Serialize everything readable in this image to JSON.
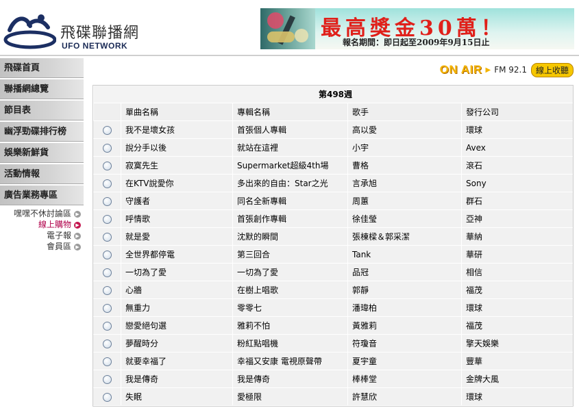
{
  "header": {
    "site_name": "飛碟聯播網",
    "site_sub": "UFO NETWORK",
    "banner_headline": "最高獎金30萬！",
    "banner_sub": "報名期間：即日起至2009年9月15日止"
  },
  "sidebar": {
    "items": [
      {
        "label": "飛碟首頁"
      },
      {
        "label": "聯播網總覽"
      },
      {
        "label": "節目表"
      },
      {
        "label": "幽浮勁碟排行榜"
      },
      {
        "label": "娛樂新鮮貨"
      },
      {
        "label": "活動情報"
      },
      {
        "label": "廣告業務專區"
      }
    ],
    "sub_links": [
      {
        "label": "嘿嘿不休討論區"
      },
      {
        "label": "線上購物"
      },
      {
        "label": "電子報"
      },
      {
        "label": "會員區"
      }
    ]
  },
  "onair": {
    "label": "ON AIR",
    "frequency": "FM 92.1",
    "listen_button": "線上收聽"
  },
  "chart": {
    "week": "第498週",
    "headers": {
      "song": "單曲名稱",
      "album": "專輯名稱",
      "artist": "歌手",
      "label": "發行公司"
    },
    "rows": [
      {
        "song": "我不是壞女孩",
        "album": "首張個人專輯",
        "artist": "高以愛",
        "label": "環球"
      },
      {
        "song": "說分手以後",
        "album": "就站在這裡",
        "artist": "小宇",
        "label": "Avex"
      },
      {
        "song": "寂寞先生",
        "album": "Supermarket超級4th場",
        "artist": "曹格",
        "label": "滾石"
      },
      {
        "song": "在KTV說愛你",
        "album": "多出來的自由：Star之光",
        "artist": "言承旭",
        "label": "Sony"
      },
      {
        "song": "守護者",
        "album": "同名全新專輯",
        "artist": "周蕙",
        "label": "群石"
      },
      {
        "song": "呼情歌",
        "album": "首張創作專輯",
        "artist": "徐佳瑩",
        "label": "亞神"
      },
      {
        "song": "就是愛",
        "album": "沈默的瞬間",
        "artist": "張棟樑＆郭采潔",
        "label": "華納"
      },
      {
        "song": "全世界都停電",
        "album": "第三回合",
        "artist": "Tank",
        "label": "華研"
      },
      {
        "song": "一切為了愛",
        "album": "一切為了愛",
        "artist": "品冠",
        "label": "相信"
      },
      {
        "song": "心牆",
        "album": "在樹上唱歌",
        "artist": "郭靜",
        "label": "福茂"
      },
      {
        "song": "無重力",
        "album": "零零七",
        "artist": "潘瑋柏",
        "label": "環球"
      },
      {
        "song": "戀愛絕句選",
        "album": "雅莉不怕",
        "artist": "黃雅莉",
        "label": "福茂"
      },
      {
        "song": "夢醒時分",
        "album": "粉紅點唱機",
        "artist": "符瓊音",
        "label": "擎天娛樂"
      },
      {
        "song": "就要幸福了",
        "album": "幸福又安康 電視原聲帶",
        "artist": "夏宇童",
        "label": "豐華"
      },
      {
        "song": "我是傳奇",
        "album": "我是傳奇",
        "artist": "棒棒堂",
        "label": "金牌大風"
      },
      {
        "song": "失眠",
        "album": "愛極限",
        "artist": "許慧欣",
        "label": "環球"
      }
    ]
  },
  "colors": {
    "accent": "#f4b400",
    "banner_red": "#e0201a",
    "active_link": "#b0004a",
    "nav_bg": "#c8c8c8",
    "table_bg": "#f1f1f1"
  }
}
